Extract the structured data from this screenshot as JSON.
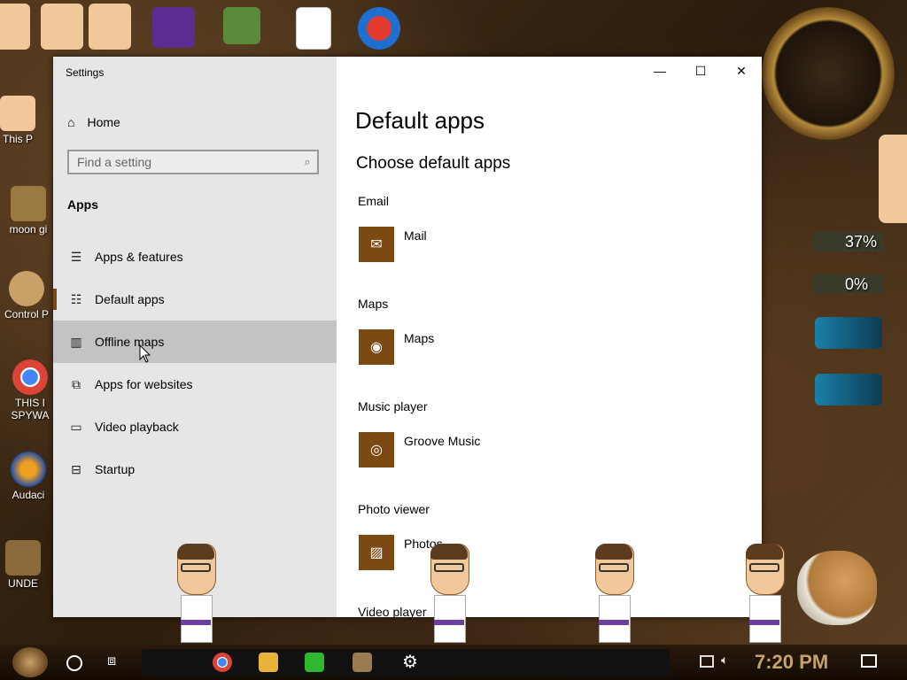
{
  "desktop": {
    "icons_left": [
      {
        "label": "This P",
        "icon": "this-pc-icon"
      },
      {
        "label": "moon gi",
        "icon": "moon-game-icon"
      },
      {
        "label": "Control P",
        "icon": "control-panel-icon"
      },
      {
        "label": "THIS I SPYWA",
        "icon": "chrome-icon"
      },
      {
        "label": "Audaci",
        "icon": "audacity-icon"
      },
      {
        "label": "UNDE",
        "icon": "folder-icon"
      }
    ],
    "meters": {
      "cpu": "37%",
      "mem": "0%"
    }
  },
  "window": {
    "title": "Settings",
    "buttons": {
      "minimize": "—",
      "maximize": "☐",
      "close": "✕"
    }
  },
  "sidebar": {
    "home_label": "Home",
    "search_placeholder": "Find a setting",
    "section_title": "Apps",
    "items": [
      {
        "label": "Apps & features",
        "icon": "apps-features-icon"
      },
      {
        "label": "Default apps",
        "icon": "default-apps-icon"
      },
      {
        "label": "Offline maps",
        "icon": "offline-maps-icon"
      },
      {
        "label": "Apps for websites",
        "icon": "apps-websites-icon"
      },
      {
        "label": "Video playback",
        "icon": "video-playback-icon"
      },
      {
        "label": "Startup",
        "icon": "startup-icon"
      }
    ]
  },
  "main": {
    "page_title": "Default apps",
    "subtitle": "Choose default apps",
    "categories": [
      {
        "label": "Email",
        "app": "Mail",
        "icon": "mail-icon"
      },
      {
        "label": "Maps",
        "app": "Maps",
        "icon": "maps-icon"
      },
      {
        "label": "Music player",
        "app": "Groove Music",
        "icon": "groove-music-icon"
      },
      {
        "label": "Photo viewer",
        "app": "Photos",
        "icon": "photos-icon"
      },
      {
        "label": "Video player",
        "app": "",
        "icon": ""
      }
    ]
  },
  "taskbar": {
    "time": "7:20 PM",
    "apps": [
      "chrome-icon",
      "file-explorer-icon",
      "notes-icon",
      "game-icon",
      "settings-gear-icon"
    ]
  },
  "colors": {
    "accent": "#7a4a12",
    "sidebar_bg": "#e6e6e6",
    "hover_bg": "#c3c3c3",
    "clock_text": "#c6a36a"
  }
}
